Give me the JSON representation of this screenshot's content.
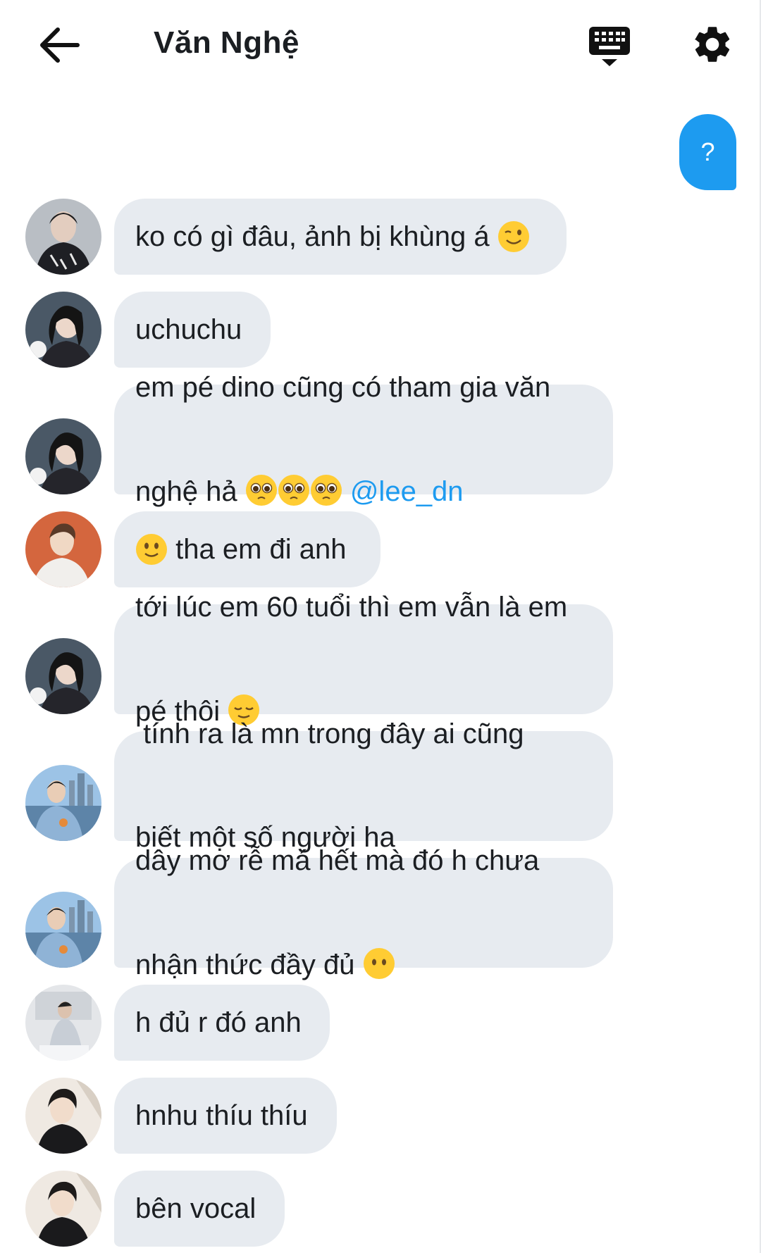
{
  "header": {
    "title": "Văn Nghệ",
    "back_icon": "arrow-left-icon",
    "keyboard_icon": "keyboard-icon",
    "settings_icon": "gear-icon"
  },
  "own_message": {
    "text": "?"
  },
  "colors": {
    "accent": "#1d9bf0",
    "bubble_bg": "#e7ebf0",
    "text": "#1b1e22",
    "emoji_yellow": "#ffcc33"
  },
  "messages": [
    {
      "text": "ko có gì đâu, ảnh bị khùng á ",
      "emoji": "winking-face"
    },
    {
      "text": "uchuchu"
    },
    {
      "line1": "em pé dino cũng có tham gia văn",
      "line2": "nghệ hả ",
      "emoji": "pleading-face",
      "mention": "@lee_dn"
    },
    {
      "text": " tha em đi anh",
      "emoji": "slightly-smiling-face"
    },
    {
      "line1": "tới lúc em 60 tuổi thì em vẫn là em",
      "line2": "pé thôi ",
      "emoji": "relieved-face"
    },
    {
      "line1": " tính ra là mn trong đây ai cũng",
      "line2": "biết một số người ha"
    },
    {
      "line1": "dây mơ rễ má hết mà đó h chưa",
      "line2": "nhận thức đầy đủ ",
      "emoji": "face-without-mouth"
    },
    {
      "text": "h đủ r đó anh"
    },
    {
      "text": "hnhu thíu thíu"
    },
    {
      "text": "bên vocal"
    }
  ]
}
